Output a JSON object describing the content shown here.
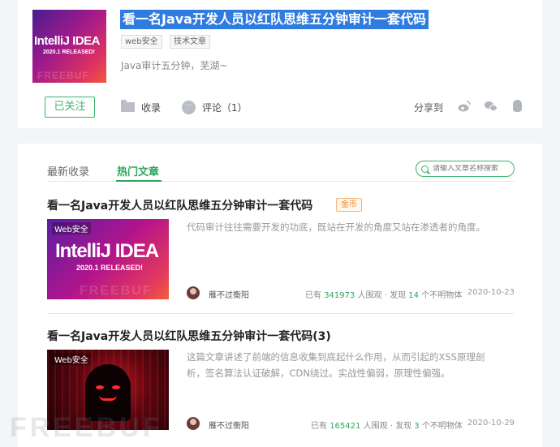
{
  "header": {
    "title": "看一名Java开发人员以红队思维五分钟审计一套代码",
    "tags": [
      "web安全",
      "技术文章"
    ],
    "description": "Java审计五分钟，芜湖~",
    "cover": {
      "logo": "IntelliJ IDEA",
      "sub": "2020.1 RELEASED!",
      "watermark": "FREEBUF"
    }
  },
  "actions": {
    "follow_label": "已关注",
    "favorite_label": "收录",
    "comment_label": "评论",
    "comment_count": "（1）",
    "share_label": "分享到"
  },
  "tabs": [
    {
      "label": "最新收录",
      "active": false
    },
    {
      "label": "热门文章",
      "active": true
    }
  ],
  "search": {
    "placeholder": "请输入文章名称搜索"
  },
  "articles": [
    {
      "title": "看一名Java开发人员以红队思维五分钟审计一套代码",
      "badge": "金币",
      "thumb_label": "Web安全",
      "thumb_big": "IntelliJ IDEA",
      "thumb_small": "2020.1 RELEASED!",
      "thumb_watermark": "FREEBUF",
      "excerpt": "代码审计往往需要开发的功底，既站在开发的角度又站在渗透者的角度。",
      "author": "雁不过衡阳",
      "views_prefix": "已有",
      "views": "341973",
      "views_suffix": "人围观",
      "finds_prefix": "· 发现",
      "finds": "14",
      "finds_suffix": "个不明物体",
      "date": "2020-10-23"
    },
    {
      "title": "看一名Java开发人员以红队思维五分钟审计一套代码(3)",
      "thumb_label": "Web安全",
      "excerpt": "这篇文章讲述了前端的信息收集到底起什么作用，从而引起的XSS原理剖析，签名算法认证破解，CDN绕过。实战性偏弱，原理性偏强。",
      "author": "雁不过衡阳",
      "views_prefix": "已有",
      "views": "165421",
      "views_suffix": "人围观",
      "finds_prefix": "· 发现",
      "finds": "3",
      "finds_suffix": "个不明物体",
      "date": "2020-10-29"
    }
  ],
  "footer_watermark": "FREEBUF",
  "colors": {
    "accent": "#2da75a",
    "title_highlight": "#2f7ce0",
    "badge": "#f08a24"
  }
}
